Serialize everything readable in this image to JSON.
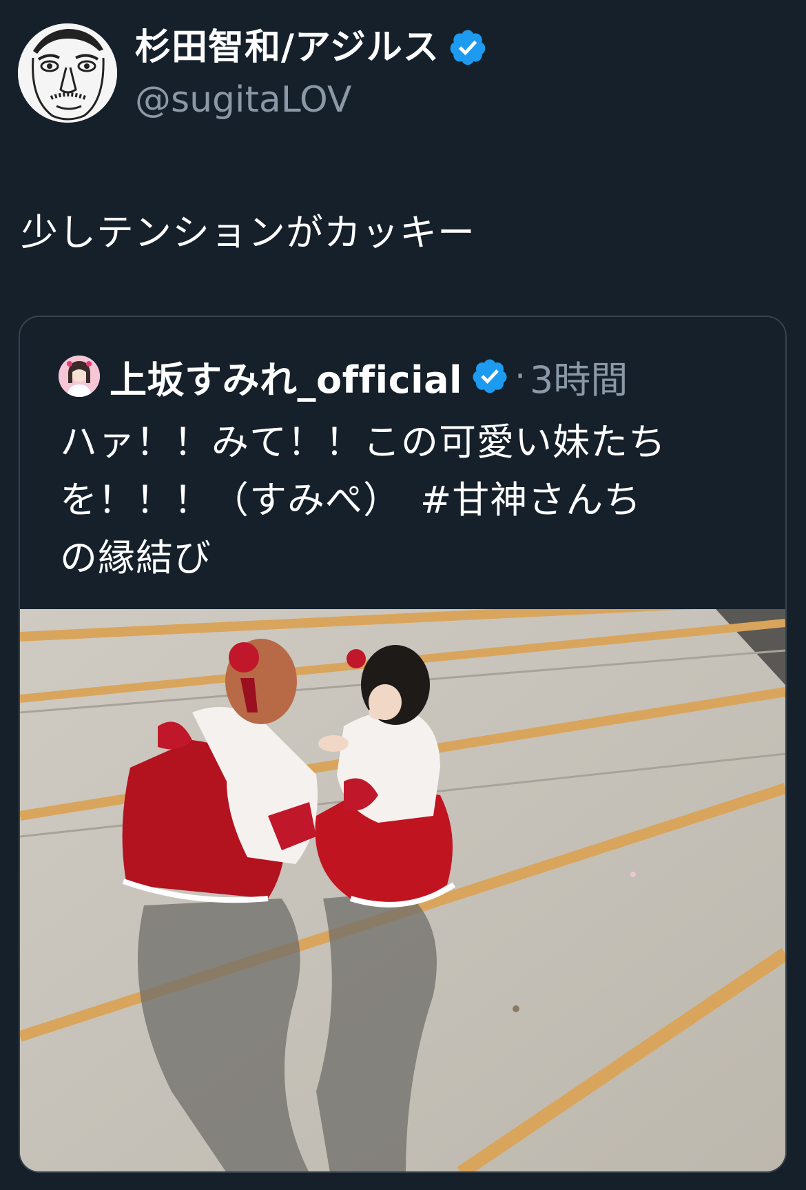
{
  "tweet": {
    "author": {
      "display_name": "杉田智和/アジルス",
      "handle": "@sugitaLOV",
      "verified": true
    },
    "text": "少しテンションがカッキー"
  },
  "quoted_tweet": {
    "author": {
      "display_name": "上坂すみれ_official",
      "verified": true
    },
    "separator": "·",
    "time": "3時間",
    "text_lines": [
      "ハァ！！みて！！この可愛い妹たち",
      "を！！！（すみぺ）　#甘神さんち",
      "の縁結び"
    ]
  },
  "colors": {
    "background": "#15202b",
    "secondary_text": "#8b98a5",
    "border": "#38444d",
    "verified_badge": "#1d9bf0"
  },
  "icons": {
    "verified": "verified-badge-icon"
  }
}
